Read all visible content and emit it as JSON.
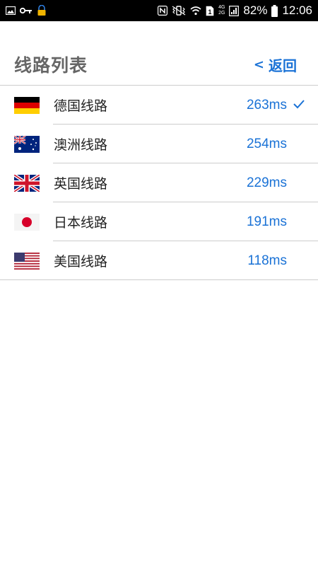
{
  "status_bar": {
    "battery_percent": "82%",
    "time": "12:06",
    "net_top": "4G",
    "net_bottom": "2G",
    "sim_slot": "1",
    "icons": [
      "image-icon",
      "key-icon",
      "vpn-lock-icon",
      "nfc-icon",
      "vibrate-icon",
      "wifi-icon",
      "sim-icon",
      "signal-icon",
      "battery-icon"
    ]
  },
  "header": {
    "title": "线路列表",
    "back_label": "返回"
  },
  "routes": [
    {
      "name": "德国线路",
      "latency": "263ms",
      "flag": "germany-flag-icon",
      "selected": true
    },
    {
      "name": "澳洲线路",
      "latency": "254ms",
      "flag": "australia-flag-icon",
      "selected": false
    },
    {
      "name": "英国线路",
      "latency": "229ms",
      "flag": "uk-flag-icon",
      "selected": false
    },
    {
      "name": "日本线路",
      "latency": "191ms",
      "flag": "japan-flag-icon",
      "selected": false
    },
    {
      "name": "美国线路",
      "latency": "118ms",
      "flag": "usa-flag-icon",
      "selected": false
    }
  ],
  "colors": {
    "accent": "#1a72d6",
    "title": "#666666",
    "divider": "#cccccc",
    "status_bar": "#000000"
  }
}
